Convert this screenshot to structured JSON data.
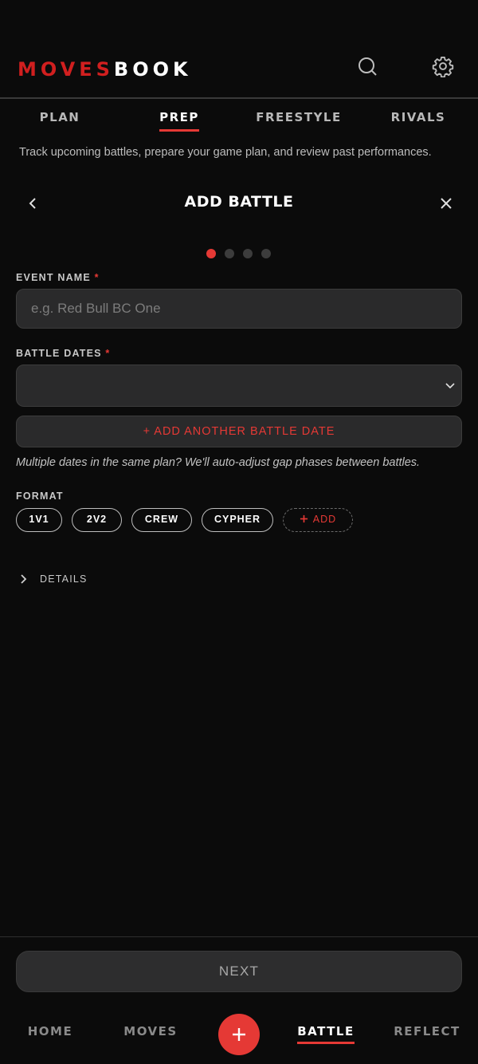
{
  "app": {
    "logo_part1": "MOVES",
    "logo_part2": "BOOK"
  },
  "header": {
    "icons": [
      "search-icon",
      "gear-icon"
    ]
  },
  "tabs": [
    {
      "label": "PLAN",
      "active": false
    },
    {
      "label": "PREP",
      "active": true
    },
    {
      "label": "FREESTYLE",
      "active": false
    },
    {
      "label": "RIVALS",
      "active": false
    }
  ],
  "subtitle": "Track upcoming battles, prepare your game plan, and review past performances.",
  "modal": {
    "title": "ADD BATTLE",
    "steps_total": 4,
    "current_step": 1
  },
  "form": {
    "event_name": {
      "label": "EVENT NAME",
      "required_mark": "*",
      "placeholder": "e.g. Red Bull BC One",
      "value": ""
    },
    "battle_dates": {
      "label": "BATTLE DATES",
      "required_mark": "*",
      "value": ""
    },
    "add_date_label": "+ ADD ANOTHER BATTLE DATE",
    "hint": "Multiple dates in the same plan? We'll auto-adjust gap phases between battles.",
    "format": {
      "label": "FORMAT",
      "options": [
        "1V1",
        "2V2",
        "CREW",
        "CYPHER"
      ],
      "add_label": "ADD"
    },
    "details_label": "DETAILS"
  },
  "next_label": "NEXT",
  "bottom_nav": [
    {
      "label": "HOME",
      "active": false
    },
    {
      "label": "MOVES",
      "active": false
    },
    {
      "label": "BATTLE",
      "active": true
    },
    {
      "label": "REFLECT",
      "active": false
    }
  ],
  "colors": {
    "accent": "#e53935",
    "background": "#0b0b0b",
    "surface": "#2a2a2b"
  }
}
